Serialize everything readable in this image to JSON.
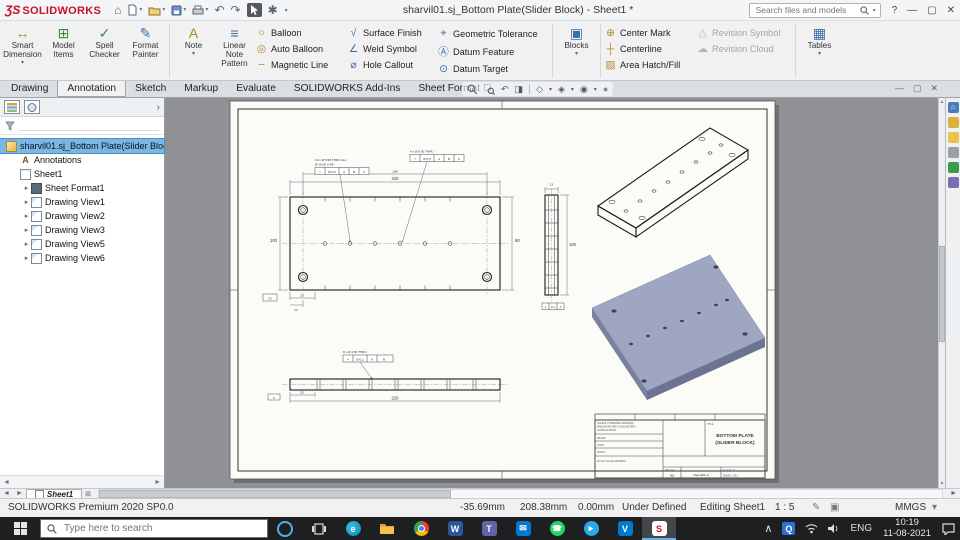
{
  "titlebar": {
    "logo_ds": "ƷS",
    "logo_text": "SOLIDWORKS",
    "title": "sharvil01.sj_Bottom Plate(Slider Block) - Sheet1 *",
    "search_placeholder": "Search files and models"
  },
  "glyphs": {
    "home": "⌂",
    "undo": "↶",
    "redo": "↷",
    "gear": "✱",
    "caret": "▾",
    "help": "?",
    "min": "—",
    "max": "▢",
    "close": "✕",
    "chev": "›",
    "left": "◄",
    "right": "►",
    "expand": "▸",
    "section": "◨",
    "orient": "◇",
    "display": "◈",
    "eye": "◉",
    "ball": "●",
    "caret_up": "∧",
    "addsheet": "⊞",
    "ann": "A",
    "pencil": "✎",
    "box": "▣"
  },
  "ribbon": {
    "large": [
      {
        "icon": "↔",
        "l1": "Smart",
        "l2": "Dimension",
        "arrow": "▾"
      },
      {
        "icon": "⊞",
        "l1": "Model",
        "l2": "Items",
        "arrow": ""
      },
      {
        "icon": "✓",
        "l1": "Spell",
        "l2": "Checker",
        "arrow": ""
      },
      {
        "icon": "✎",
        "l1": "Format",
        "l2": "Painter",
        "arrow": ""
      },
      {
        "icon": "A",
        "l1": "Note",
        "l2": "",
        "arrow": "▾"
      },
      {
        "icon": "≡",
        "l1": "Linear Note",
        "l2": "Pattern",
        "arrow": ""
      }
    ],
    "cols": [
      [
        {
          "icon": "○",
          "label": "Balloon"
        },
        {
          "icon": "◎",
          "label": "Auto Balloon"
        },
        {
          "icon": "╌",
          "label": "Magnetic Line"
        }
      ],
      [
        {
          "icon": "√",
          "label": "Surface Finish"
        },
        {
          "icon": "∠",
          "label": "Weld Symbol"
        },
        {
          "icon": "⌀",
          "label": "Hole Callout"
        }
      ],
      [
        {
          "icon": "⌖",
          "label": "Geometric Tolerance"
        },
        {
          "icon": "Ⓐ",
          "label": "Datum Feature"
        },
        {
          "icon": "⊙",
          "label": "Datum Target"
        }
      ],
      [
        {
          "icon": "⊕",
          "label": "Center Mark"
        },
        {
          "icon": "┼",
          "label": "Centerline"
        },
        {
          "icon": "▨",
          "label": "Area Hatch/Fill"
        }
      ],
      [
        {
          "icon": "△",
          "label": "Revision Symbol"
        },
        {
          "icon": "☁",
          "label": "Revision Cloud"
        }
      ]
    ],
    "blocks": {
      "icon": "▣",
      "l1": "Blocks",
      "arrow": "▾"
    },
    "tables": {
      "icon": "▦",
      "l1": "Tables",
      "arrow": "▾"
    }
  },
  "tabs": {
    "items": [
      "Drawing",
      "Annotation",
      "Sketch",
      "Markup",
      "Evaluate",
      "SOLIDWORKS Add-Ins",
      "Sheet Format"
    ]
  },
  "tree": {
    "root": "sharvil01.sj_Bottom Plate(Slider Block)",
    "annotations": "Annotations",
    "sheet1": "Sheet1",
    "children": [
      "Sheet Format1",
      "Drawing View1",
      "Drawing View2",
      "Drawing View3",
      "Drawing View5",
      "Drawing View6"
    ]
  },
  "drawing": {
    "callout1a": "10 x Ø 5.50 THRU ALL",
    "callout1b": "Ø 10.00 X 90°",
    "fcf1": {
      "sym": "⌖",
      "tol": "Ø 0.5",
      "d1": "A",
      "d2": "B",
      "d3": "C"
    },
    "callout2a": "4 x Ø 6.60 THRU",
    "fcf2": {
      "sym": "⌖",
      "tol": "Ø 0.5",
      "d1": "A",
      "d2": "B",
      "d3": "C"
    },
    "callout3a": "8 x Ø 4.50 THRU",
    "fcf3": {
      "sym": "⌖",
      "tol": "Ø 0.2",
      "d1": "A",
      "d2": "B"
    },
    "dim_width": "220",
    "dim_width2": "184",
    "dim_height": "100",
    "dim_height2": "80",
    "dim_pitch": "25",
    "dim_small": "13",
    "dim_box": "25",
    "dim_thick": "13",
    "dim_side_height": "100",
    "gdt_side_tol": "0.1",
    "gdt_side_d": "A",
    "dim_len": "220",
    "dim_off": "25",
    "dim_box2": "6",
    "title_block": {
      "notes1": "UNLESS OTHERWISE SPECIFIED:",
      "notes2": "DIMENSIONS ARE IN MILLIMETERS",
      "notes3": "SURFACE FINISH:",
      "notes4": "TOLERANCES:",
      "r1": "DRAWN",
      "r2": "CHK'D",
      "r3": "APPV'D",
      "r4": "MFG",
      "title_label": "TITLE:",
      "title1": "BOTTOM PLATE",
      "title2": "(SLIDER BLOCK)",
      "dwg_label": "DWG NO.",
      "size": "A3",
      "dwg_no": "sharvil01.sj",
      "scale": "SCALE: 1:5",
      "sheet": "SHEET 1 OF 1",
      "dnsd": "DO NOT SCALE DRAWING"
    }
  },
  "statusbar": {
    "product": "SOLIDWORKS Premium 2020 SP0.0",
    "x": "-35.69mm",
    "y": "208.38mm",
    "z": "0.00mm",
    "state": "Under Defined",
    "mode": "Editing Sheet1",
    "scale": "1 : 5",
    "units": "MMGS"
  },
  "sheettabs": {
    "active": "Sheet1"
  },
  "taskbar": {
    "search_placeholder": "Type here to search",
    "edge": "e",
    "word": "W",
    "teams": "T",
    "mail": "✉",
    "whatsapp": "☎",
    "telegram": "▸",
    "vscode": "V",
    "solidworks": "S",
    "q": "Q",
    "lang": "ENG",
    "time": "10:19",
    "date": "11-08-2021"
  }
}
